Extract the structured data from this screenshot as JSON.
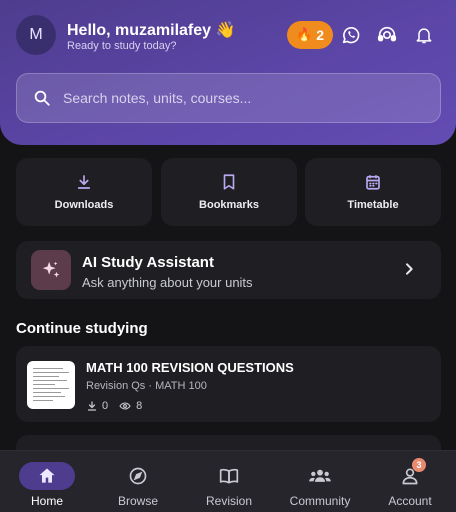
{
  "header": {
    "avatar_initial": "M",
    "greeting": "Hello, muzamilafey 👋",
    "subgreeting": "Ready to study today?",
    "streak_count": "2",
    "search_placeholder": "Search notes, units, courses..."
  },
  "quick_actions": [
    {
      "label": "Downloads",
      "icon": "download-icon"
    },
    {
      "label": "Bookmarks",
      "icon": "bookmark-icon"
    },
    {
      "label": "Timetable",
      "icon": "calendar-icon"
    }
  ],
  "assistant": {
    "title": "AI Study Assistant",
    "subtitle": "Ask anything about your units"
  },
  "continue": {
    "title": "Continue studying",
    "items": [
      {
        "title": "MATH 100 REVISION QUESTIONS",
        "subtitle": "Revision Qs · MATH 100",
        "downloads": "0",
        "views": "8"
      }
    ]
  },
  "nav": [
    {
      "label": "Home",
      "icon": "home-icon",
      "active": true
    },
    {
      "label": "Browse",
      "icon": "compass-icon"
    },
    {
      "label": "Revision",
      "icon": "book-icon"
    },
    {
      "label": "Community",
      "icon": "people-icon"
    },
    {
      "label": "Account",
      "icon": "account-icon",
      "badge": "3"
    }
  ],
  "colors": {
    "header": "#5b45a6",
    "streak": "#f08c1e",
    "surface": "#1f1f23",
    "background": "#141416",
    "badge": "#e88a6f"
  }
}
